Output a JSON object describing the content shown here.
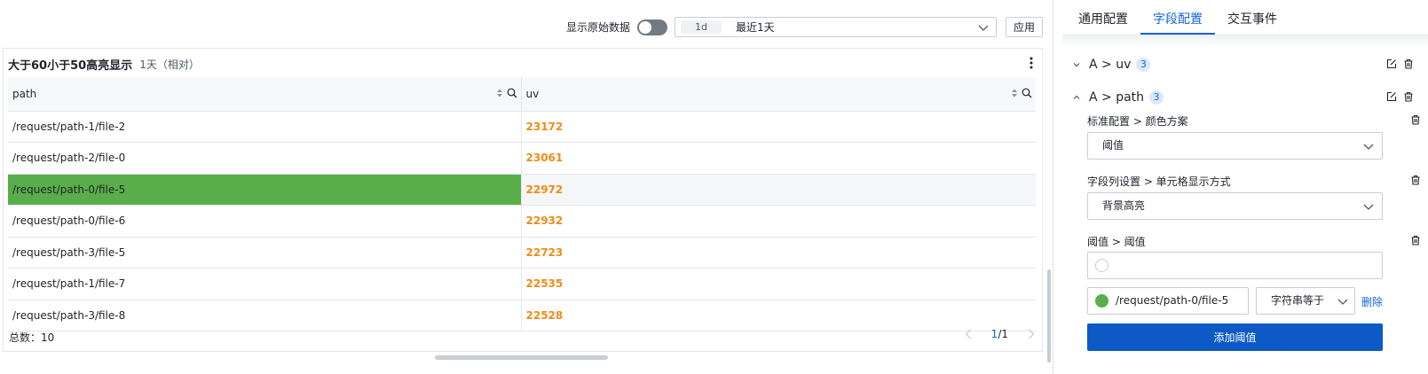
{
  "toolbar": {
    "raw_label": "显示原始数据",
    "time_tag": "1d",
    "time_value": "最近1天",
    "apply_label": "应用"
  },
  "panel": {
    "title": "大于60小于50高亮显示",
    "subtitle": "1天（相对）",
    "columns": [
      "path",
      "uv"
    ],
    "rows": [
      {
        "path": "/request/path-1/file-2",
        "uv": "23172"
      },
      {
        "path": "/request/path-2/file-0",
        "uv": "23061"
      },
      {
        "path": "/request/path-0/file-5",
        "uv": "22972",
        "highlight": true
      },
      {
        "path": "/request/path-0/file-6",
        "uv": "22932"
      },
      {
        "path": "/request/path-3/file-5",
        "uv": "22723"
      },
      {
        "path": "/request/path-1/file-7",
        "uv": "22535"
      },
      {
        "path": "/request/path-3/file-8",
        "uv": "22528"
      }
    ],
    "total_label": "总数：10",
    "page_current": "1",
    "page_total": "/1"
  },
  "config": {
    "tabs": [
      "通用配置",
      "字段配置",
      "交互事件"
    ],
    "active_tab": 1,
    "groups": [
      {
        "title": "A > uv",
        "count": "3",
        "expanded": false
      },
      {
        "title": "A > path",
        "count": "3",
        "expanded": true
      }
    ],
    "items": [
      {
        "label": "标准配置 > 颜色方案",
        "value": "阈值"
      },
      {
        "label": "字段列设置 > 单元格显示方式",
        "value": "背景高亮"
      },
      {
        "label": "阈值 > 阈值"
      }
    ],
    "rule": {
      "value": "/request/path-0/file-5",
      "operator": "字符串等于",
      "delete_label": "删除",
      "color": "#5aad4b"
    },
    "add_label": "添加阈值"
  },
  "colors": {
    "accent": "#1664d6",
    "highlight": "#5aad4b",
    "number": "#f08b18"
  }
}
